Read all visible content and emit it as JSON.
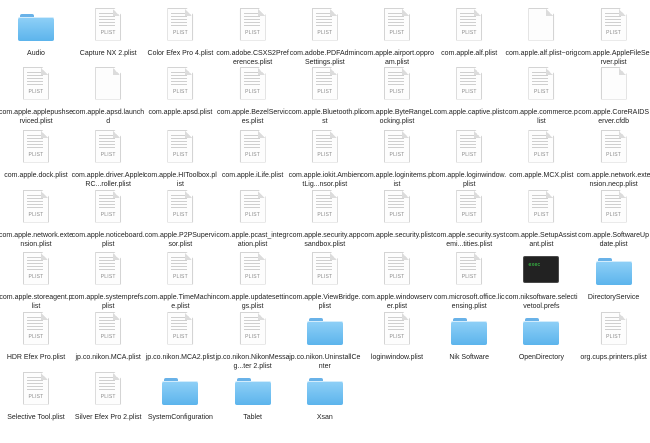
{
  "window": {
    "title": ""
  },
  "colors": {
    "folder": "#6ebff2",
    "plist_tag": "#8a8a8a",
    "terminal_prompt": "#3cdc4c",
    "background": "#ffffff"
  },
  "items": [
    {
      "label": "Audio",
      "icon": "folder-icon"
    },
    {
      "label": "Capture NX 2.plist",
      "icon": "plist-icon",
      "tag": "PLIST"
    },
    {
      "label": "Color Efex Pro 4.plist",
      "icon": "plist-icon",
      "tag": "PLIST"
    },
    {
      "label": "com.adobe.CSXS2Preferences.plist",
      "icon": "plist-icon",
      "tag": "PLIST"
    },
    {
      "label": "com.adobe.PDFAdminSettings.plist",
      "icon": "plist-icon",
      "tag": "PLIST"
    },
    {
      "label": "com.apple.airport.opproam.plist",
      "icon": "plist-icon",
      "tag": "PLIST"
    },
    {
      "label": "com.apple.alf.plist",
      "icon": "plist-icon",
      "tag": "PLIST"
    },
    {
      "label": "com.apple.alf.plist~orig",
      "icon": "document-icon",
      "tag": ""
    },
    {
      "label": "com.apple.AppleFileServer.plist",
      "icon": "plist-icon",
      "tag": "PLIST"
    },
    {
      "label": "com.apple.applepushserviced.plist",
      "icon": "plist-icon",
      "tag": "PLIST"
    },
    {
      "label": "com.apple.apsd.launchd",
      "icon": "document-icon",
      "tag": ""
    },
    {
      "label": "com.apple.apsd.plist",
      "icon": "plist-icon",
      "tag": "PLIST"
    },
    {
      "label": "com.apple.BezelServices.plist",
      "icon": "plist-icon",
      "tag": "PLIST"
    },
    {
      "label": "com.apple.Bluetooth.plist",
      "icon": "plist-icon",
      "tag": "PLIST"
    },
    {
      "label": "com.apple.ByteRangeLocking.plist",
      "icon": "plist-icon",
      "tag": "PLIST"
    },
    {
      "label": "com.apple.captive.plist",
      "icon": "plist-icon",
      "tag": "PLIST"
    },
    {
      "label": "com.apple.commerce.plist",
      "icon": "plist-icon",
      "tag": "PLIST"
    },
    {
      "label": "com.apple.CoreRAIDServer.cfdb",
      "icon": "document-icon",
      "tag": ""
    },
    {
      "label": "com.apple.dock.plist",
      "icon": "plist-icon",
      "tag": "PLIST"
    },
    {
      "label": "com.apple.driver.AppleIRC...roller.plist",
      "icon": "plist-icon",
      "tag": "PLIST"
    },
    {
      "label": "com.apple.HIToolbox.plist",
      "icon": "plist-icon",
      "tag": "PLIST"
    },
    {
      "label": "com.apple.iLife.plist",
      "icon": "plist-icon",
      "tag": "PLIST"
    },
    {
      "label": "com.apple.iokit.AmbientLig...nsor.plist",
      "icon": "plist-icon",
      "tag": "PLIST"
    },
    {
      "label": "com.apple.loginitems.plist",
      "icon": "plist-icon",
      "tag": "PLIST"
    },
    {
      "label": "com.apple.loginwindow.plist",
      "icon": "plist-icon",
      "tag": "PLIST"
    },
    {
      "label": "com.apple.MCX.plist",
      "icon": "plist-icon",
      "tag": "PLIST"
    },
    {
      "label": "com.apple.network.extension.necp.plist",
      "icon": "plist-icon",
      "tag": "PLIST"
    },
    {
      "label": "com.apple.network.extension.plist",
      "icon": "plist-icon",
      "tag": "PLIST"
    },
    {
      "label": "com.apple.noticeboard.plist",
      "icon": "plist-icon",
      "tag": "PLIST"
    },
    {
      "label": "com.apple.P2PSupervisor.plist",
      "icon": "plist-icon",
      "tag": "PLIST"
    },
    {
      "label": "com.apple.pcast_integration.plist",
      "icon": "plist-icon",
      "tag": "PLIST"
    },
    {
      "label": "com.apple.security.appsandbox.plist",
      "icon": "plist-icon",
      "tag": "PLIST"
    },
    {
      "label": "com.apple.security.plist",
      "icon": "plist-icon",
      "tag": "PLIST"
    },
    {
      "label": "com.apple.security.systemi...tities.plist",
      "icon": "plist-icon",
      "tag": "PLIST"
    },
    {
      "label": "com.apple.SetupAssistant.plist",
      "icon": "plist-icon",
      "tag": "PLIST"
    },
    {
      "label": "com.apple.SoftwareUpdate.plist",
      "icon": "plist-icon",
      "tag": "PLIST"
    },
    {
      "label": "com.apple.storeagent.plist",
      "icon": "plist-icon",
      "tag": "PLIST"
    },
    {
      "label": "com.apple.systemprefs.plist",
      "icon": "plist-icon",
      "tag": "PLIST"
    },
    {
      "label": "com.apple.TimeMachine.plist",
      "icon": "plist-icon",
      "tag": "PLIST"
    },
    {
      "label": "com.apple.updatesettings.plist",
      "icon": "plist-icon",
      "tag": "PLIST"
    },
    {
      "label": "com.apple.ViewBridge.plist",
      "icon": "plist-icon",
      "tag": "PLIST"
    },
    {
      "label": "com.apple.windowserver.plist",
      "icon": "plist-icon",
      "tag": "PLIST"
    },
    {
      "label": "com.microsoft.office.licensing.plist",
      "icon": "plist-icon",
      "tag": "PLIST"
    },
    {
      "label": "com.niksoftware.selectivetool.prefs",
      "icon": "terminal-icon",
      "tag": "exec"
    },
    {
      "label": "DirectoryService",
      "icon": "folder-icon"
    },
    {
      "label": "HDR Efex Pro.plist",
      "icon": "plist-icon",
      "tag": "PLIST"
    },
    {
      "label": "jp.co.nikon.MCA.plist",
      "icon": "plist-icon",
      "tag": "PLIST"
    },
    {
      "label": "jp.co.nikon.MCA2.plist",
      "icon": "plist-icon",
      "tag": "PLIST"
    },
    {
      "label": "jp.co.nikon.NikonMessag...ter 2.plist",
      "icon": "plist-icon",
      "tag": "PLIST"
    },
    {
      "label": "jp.co.nikon.UninstallCenter",
      "icon": "folder-icon"
    },
    {
      "label": "loginwindow.plist",
      "icon": "plist-icon",
      "tag": "PLIST"
    },
    {
      "label": "Nik Software",
      "icon": "folder-icon"
    },
    {
      "label": "OpenDirectory",
      "icon": "folder-icon"
    },
    {
      "label": "org.cups.printers.plist",
      "icon": "plist-icon",
      "tag": "PLIST"
    },
    {
      "label": "Selective Tool.plist",
      "icon": "plist-icon",
      "tag": "PLIST"
    },
    {
      "label": "Silver Efex Pro 2.plist",
      "icon": "plist-icon",
      "tag": "PLIST"
    },
    {
      "label": "SystemConfiguration",
      "icon": "folder-icon"
    },
    {
      "label": "Tablet",
      "icon": "folder-icon"
    },
    {
      "label": "Xsan",
      "icon": "folder-icon"
    }
  ]
}
